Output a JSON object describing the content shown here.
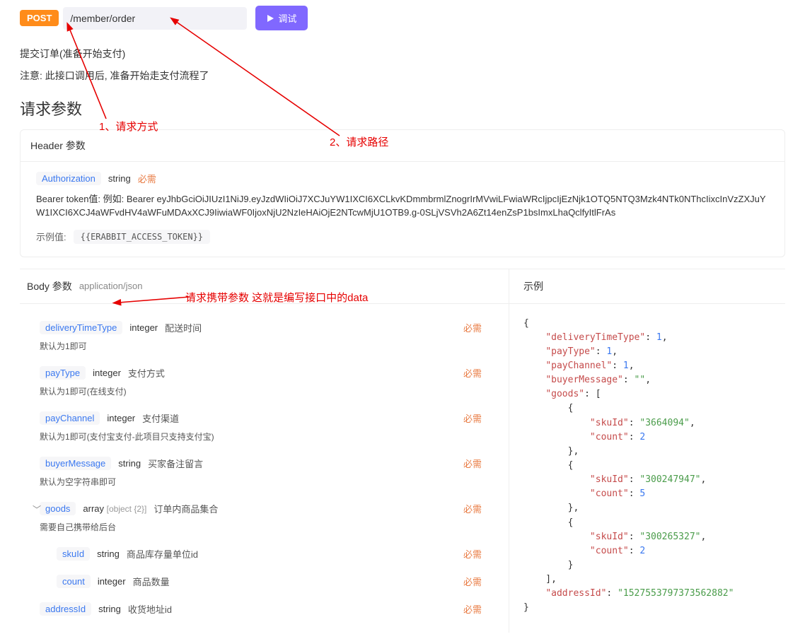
{
  "method": "POST",
  "path": "/member/order",
  "debug_label": "调试",
  "description_line1": "提交订单(准备开始支付)",
  "description_line2": "注意: 此接口调用后, 准备开始走支付流程了",
  "section_request_params": "请求参数",
  "header_panel_title": "Header 参数",
  "header_param": {
    "name": "Authorization",
    "type": "string",
    "required": "必需",
    "desc": "Bearer token值: 例如: Bearer eyJhbGciOiJIUzI1NiJ9.eyJzdWIiOiJ7XCJuYW1IXCI6XCLkvKDmmbrmlZnogrIrMVwiLFwiaWRcIjpcIjEzNjk1OTQ5NTQ3Mzk4NTk0NThcIixcInVzZXJuYW1IXCI6XCJ4aWFvdHV4aWFuMDAxXCJ9IiwiaWF0IjoxNjU2NzIeHAiOjE2NTcwMjU1OTB9.g-0SLjVSVh2A6Zt14enZsP1bsImxLhaQclfyItlFrAs",
    "example_label": "示例值:",
    "example_value": "{{ERABBIT_ACCESS_TOKEN}}"
  },
  "body_title": "Body 参数",
  "body_content_type": "application/json",
  "example_title": "示例",
  "body_params": [
    {
      "name": "deliveryTimeType",
      "type": "integer",
      "label": "配送时间",
      "note": "默认为1即可",
      "required": "必需",
      "level": 0
    },
    {
      "name": "payType",
      "type": "integer",
      "label": "支付方式",
      "note": "默认为1即可(在线支付)",
      "required": "必需",
      "level": 0
    },
    {
      "name": "payChannel",
      "type": "integer",
      "label": "支付渠道",
      "note": "默认为1即可(支付宝支付-此项目只支持支付宝)",
      "required": "必需",
      "level": 0
    },
    {
      "name": "buyerMessage",
      "type": "string",
      "label": "买家备注留言",
      "note": "默认为空字符串即可",
      "required": "必需",
      "level": 0
    },
    {
      "name": "goods",
      "type": "array",
      "extra": "[object {2}]",
      "label": "订单内商品集合",
      "note": "需要自己携带给后台",
      "required": "必需",
      "level": 0,
      "expandable": true
    },
    {
      "name": "skuId",
      "type": "string",
      "label": "商品库存量单位id",
      "note": "",
      "required": "必需",
      "level": 1
    },
    {
      "name": "count",
      "type": "integer",
      "label": "商品数量",
      "note": "",
      "required": "必需",
      "level": 1
    },
    {
      "name": "addressId",
      "type": "string",
      "label": "收货地址id",
      "note": "",
      "required": "必需",
      "level": 0
    }
  ],
  "json_example": {
    "deliveryTimeType": 1,
    "payType": 1,
    "payChannel": 1,
    "buyerMessage": "",
    "goods": [
      {
        "skuId": "3664094",
        "count": 2
      },
      {
        "skuId": "300247947",
        "count": 5
      },
      {
        "skuId": "300265327",
        "count": 2
      }
    ],
    "addressId": "1527553797373562882"
  },
  "annotations": {
    "a1": "1、请求方式",
    "a2": "2、请求路径",
    "a3": "请求携带参数 这就是编写接口中的data"
  }
}
